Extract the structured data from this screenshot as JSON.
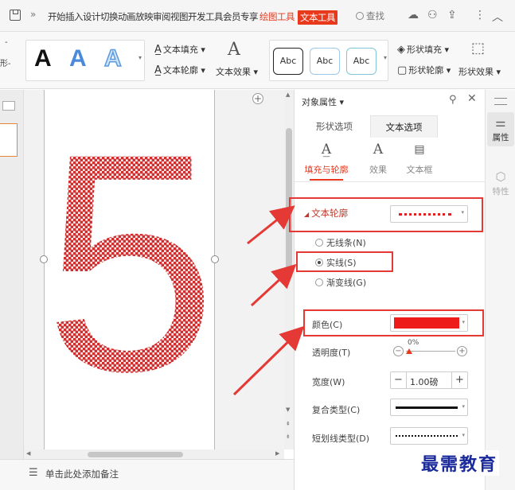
{
  "menubar": {
    "save_icon": "save-icon",
    "more": "»",
    "menus": [
      "开始",
      "插入",
      "设计",
      "切换",
      "动画",
      "放映",
      "审阅",
      "视图",
      "开发工具",
      "会员专享"
    ],
    "drawing_tools": "绘图工具",
    "text_tools": "文本工具",
    "search": "查找",
    "right_icons": [
      "cloud-icon",
      "user-icon",
      "share-icon",
      "more-vert-icon",
      "collapse-icon"
    ]
  },
  "ribbon": {
    "left_fragment_top": "-",
    "left_fragment_bottom": "形-",
    "text_style_letters": [
      "A",
      "A",
      "A"
    ],
    "text_fill": "文本填充",
    "text_outline": "文本轮廓",
    "text_effect": "文本效果",
    "shape_styles": [
      "Abc",
      "Abc",
      "Abc"
    ],
    "shape_fill": "形状填充",
    "shape_outline": "形状轮廓",
    "shape_effect": "形状效果"
  },
  "canvas": {
    "big_text": "5",
    "add_button": "+"
  },
  "notes": {
    "placeholder": "单击此处添加备注"
  },
  "panel": {
    "title": "对象属性",
    "tabs": [
      "形状选项",
      "文本选项"
    ],
    "active_tab": "文本选项",
    "subtabs": [
      "填充与轮廓",
      "效果",
      "文本框"
    ],
    "section_title": "文本轮廓",
    "radio_options": [
      {
        "label": "无线条(N)",
        "checked": false
      },
      {
        "label": "实线(S)",
        "checked": true
      },
      {
        "label": "渐变线(G)",
        "checked": false
      }
    ],
    "color_label": "颜色(C)",
    "color_value": "#ee1b1b",
    "transparency_label": "透明度(T)",
    "transparency_value": "0%",
    "width_label": "宽度(W)",
    "width_value": "1.00磅",
    "compound_label": "复合类型(C)",
    "dash_label": "短划线类型(D)"
  },
  "right_strip": {
    "properties": "属性",
    "traits": "特性"
  },
  "watermark": "最需教育",
  "colors": {
    "accent": "#e8391d",
    "highlight_box": "#e53935",
    "fill_pattern": "#d32f2f"
  }
}
